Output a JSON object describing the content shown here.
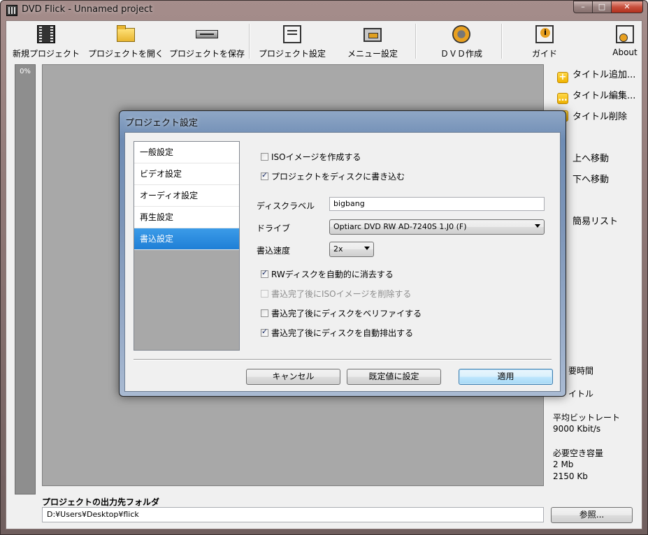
{
  "window": {
    "title": "DVD Flick - Unnamed project",
    "controls": {
      "minimize": "–",
      "maximize": "□",
      "close": "✕"
    }
  },
  "toolbar": {
    "buttons": [
      {
        "label": "新規プロジェクト",
        "icon": "film-icon"
      },
      {
        "label": "プロジェクトを開く",
        "icon": "folder-icon"
      },
      {
        "label": "プロジェクトを保存",
        "icon": "drive-icon"
      },
      {
        "label": "プロジェクト設定",
        "icon": "settings-doc-icon"
      },
      {
        "label": "メニュー設定",
        "icon": "menu-icon"
      },
      {
        "label": "ＤＶＤ作成",
        "icon": "gear-icon"
      },
      {
        "label": "ガイド",
        "icon": "guide-icon"
      },
      {
        "label": "About",
        "icon": "about-icon"
      }
    ]
  },
  "progress": {
    "label": "0%",
    "percent": 0
  },
  "right_panel": {
    "actions": [
      {
        "label": "タイトル追加...",
        "glyph": "+"
      },
      {
        "label": "タイトル編集...",
        "glyph": "…"
      },
      {
        "label": "タイトル削除",
        "glyph": ""
      },
      {
        "label": "上へ移動"
      },
      {
        "label": "下へ移動"
      },
      {
        "label": "簡易リスト"
      }
    ],
    "info": {
      "time_label": "要時間",
      "title_label": "イトル",
      "bitrate_label": "平均ビットレート",
      "bitrate_value": "9000 Kbit/s",
      "space_label": "必要空き容量",
      "space_mb": "2 Mb",
      "space_kb": "2150 Kb"
    }
  },
  "output": {
    "label": "プロジェクトの出力先フォルダ",
    "path": "D:¥Users¥Desktop¥flick",
    "browse_label": "参照..."
  },
  "dialog": {
    "title": "プロジェクト設定",
    "categories": [
      "一般設定",
      "ビデオ設定",
      "オーディオ設定",
      "再生設定",
      "書込設定"
    ],
    "selected_category": "書込設定",
    "create_iso": {
      "label": "ISOイメージを作成する",
      "checked": false
    },
    "burn_to_disc": {
      "label": "プロジェクトをディスクに書き込む",
      "checked": true
    },
    "disc_label": {
      "label": "ディスクラベル",
      "value": "bigbang"
    },
    "drive": {
      "label": "ドライブ",
      "value": "Optiarc DVD RW AD-7240S 1.J0 (F)"
    },
    "speed": {
      "label": "書込速度",
      "value": "2x"
    },
    "auto_erase": {
      "label": "RWディスクを自動的に消去する",
      "checked": true
    },
    "delete_iso": {
      "label": "書込完了後にISOイメージを削除する",
      "checked": false,
      "disabled": true
    },
    "verify": {
      "label": "書込完了後にディスクをベリファイする",
      "checked": false
    },
    "eject": {
      "label": "書込完了後にディスクを自動排出する",
      "checked": true
    },
    "buttons": {
      "cancel": "キャンセル",
      "defaults": "既定値に設定",
      "apply": "適用"
    }
  }
}
